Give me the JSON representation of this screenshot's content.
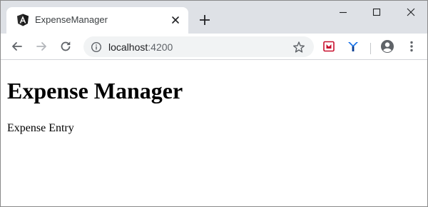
{
  "tab": {
    "title": "ExpenseManager",
    "favicon": "angular-icon"
  },
  "address_bar": {
    "host": "localhost",
    "port": ":4200"
  },
  "page": {
    "heading": "Expense Manager",
    "text": "Expense Entry"
  },
  "colors": {
    "tabstrip_bg": "#dee1e6",
    "omnibox_bg": "#f1f3f4",
    "angular_red": "#dd0031",
    "extension_red": "#c8102e",
    "extension_blue": "#1a73e8"
  }
}
